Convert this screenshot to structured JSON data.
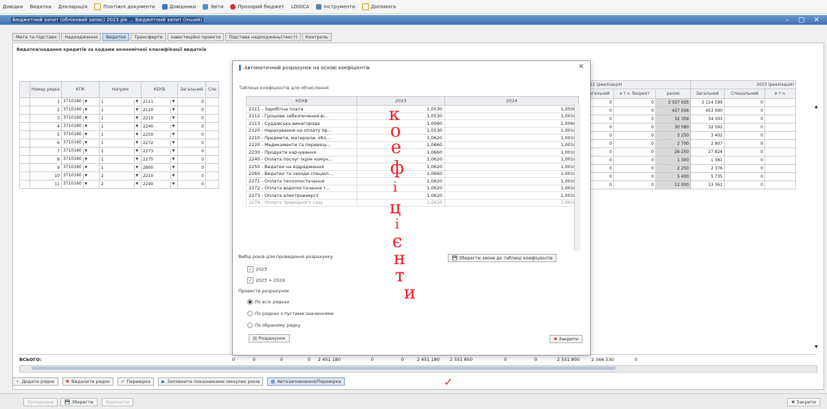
{
  "menu": [
    "Довідки",
    "Видатки",
    "Декларація",
    "Платіжні документи",
    "Довідники",
    "Звіти",
    "Прозорий бюджет",
    "LOGICA",
    "Інструменти",
    "Допомога"
  ],
  "window_title": "Бюджетний запит (обліковий запис) 2023 рік ... Бюджетний запит (Інший)",
  "tabs": [
    "Мета та підстави",
    "Надходження",
    "Видатки",
    "Трансферти",
    "Інвестиційні проекти",
    "Підстава надходжень(текст)",
    "Контроль"
  ],
  "section_title": "Видатки/надання кредитів за кодами економічної класифікації видатків",
  "left_headers": [
    "Номер рядка",
    "КПК",
    "Напрям",
    "КЕКВ",
    "Загальний",
    "Спе"
  ],
  "rows": [
    {
      "n": "1",
      "kpk": "3710160",
      "nap": "1",
      "kekv": "2111"
    },
    {
      "n": "2",
      "kpk": "3710160",
      "nap": "1",
      "kekv": "2120"
    },
    {
      "n": "3",
      "kpk": "3710160",
      "nap": "1",
      "kekv": "2210"
    },
    {
      "n": "4",
      "kpk": "3710160",
      "nap": "1",
      "kekv": "2240"
    },
    {
      "n": "5",
      "kpk": "3710160",
      "nap": "1",
      "kekv": "2250"
    },
    {
      "n": "6",
      "kpk": "3710160",
      "nap": "1",
      "kekv": "2272"
    },
    {
      "n": "7",
      "kpk": "3710160",
      "nap": "1",
      "kekv": "2273"
    },
    {
      "n": "8",
      "kpk": "3710160",
      "nap": "1",
      "kekv": "2275"
    },
    {
      "n": "9",
      "kpk": "3710160",
      "nap": "1",
      "kekv": "2800"
    },
    {
      "n": "10",
      "kpk": "3710160",
      "nap": "2",
      "kekv": "2210"
    },
    {
      "n": "11",
      "kpk": "3710160",
      "nap": "2",
      "kekv": "2240"
    }
  ],
  "right_group_2022": "2022 (реалізація)",
  "right_group_2023": "2023 (реалізація)",
  "right_headers": [
    "Загальний",
    "в т.ч. бюджет",
    "разом",
    "Загальний",
    "Спеціальний",
    "в т.ч."
  ],
  "right_rows": [
    [
      "0",
      "0",
      "2 037 025",
      "2 114 599",
      "0"
    ],
    [
      "0",
      "0",
      "437 056",
      "453 000",
      "0"
    ],
    [
      "0",
      "0",
      "32 359",
      "34 303",
      "0"
    ],
    [
      "0",
      "0",
      "30 080",
      "32 592",
      "0"
    ],
    [
      "0",
      "0",
      "3 250",
      "3 402",
      "0"
    ],
    [
      "0",
      "0",
      "2 700",
      "2 907",
      "0"
    ],
    [
      "0",
      "0",
      "26 250",
      "27 824",
      "0"
    ],
    [
      "0",
      "0",
      "1 300",
      "1 381",
      "0"
    ],
    [
      "0",
      "0",
      "2 250",
      "2 376",
      "0"
    ],
    [
      "0",
      "0",
      "5 400",
      "5 735",
      "0"
    ],
    [
      "0",
      "0",
      "12 000",
      "13 361",
      "0"
    ]
  ],
  "totals": {
    "label": "ВСЬОГО:",
    "values": [
      "0",
      "0",
      "0",
      "0",
      "2 451 180",
      "0",
      "0",
      "2 451 180",
      "2 551 850",
      "0",
      "0",
      "2 551 800",
      "2 566 530",
      "0"
    ]
  },
  "toolbar": [
    "Додати рядок",
    "Видалити рядок",
    "Перевірка",
    "Заповнити показниками минулих років",
    "Автозаповнення/Перевірка"
  ],
  "footer": {
    "first": "Попередня",
    "save": "Зберегти",
    "third": "Відмінити",
    "close": "Закрити"
  },
  "dialog": {
    "title": "Автоматичний розрахунок на основі коефіцієнтів",
    "subtitle": "Таблиця коефіцієнтів для обчислення",
    "col_headers": [
      "КЕКВ",
      "2023",
      "2024"
    ],
    "rows": [
      [
        "2111 - Заробітна плата",
        "1,0530",
        "1,0500"
      ],
      [
        "2112 - Грошове забезпечення ві...",
        "1,0530",
        "1,0010"
      ],
      [
        "2113 - Суддівська винагорода",
        "1,0060",
        "1,0060"
      ],
      [
        "2120 - Нарахування на оплату пр...",
        "1,0530",
        "1,0010"
      ],
      [
        "2210 - Предмети, матеріали, обл...",
        "1,0620",
        "1,0010"
      ],
      [
        "2220 - Медикаменти та перевязу...",
        "1,0660",
        "1,0010"
      ],
      [
        "2230 - Продукти харчування",
        "1,0660",
        "1,0010"
      ],
      [
        "2240 - Оплата послуг (крім комун...",
        "1,0620",
        "1,0010"
      ],
      [
        "2250 - Видатки на відрядження",
        "1,0620",
        "1,0010"
      ],
      [
        "2260 - Видатки та заходи спеціал...",
        "1,0660",
        "1,0010"
      ],
      [
        "2271 - Оплата теплопостачання",
        "1,0620",
        "1,0010"
      ],
      [
        "2272 - Оплата водопостачання т...",
        "1,0620",
        "1,0010"
      ],
      [
        "2273 - Оплата електроенергії",
        "1,0620",
        "1,0010"
      ],
      [
        "2274 - Оплата природного газу",
        "1,0620",
        "1,0010"
      ]
    ],
    "save_btn": "Зберегти зміни до таблиці коефіцієнтів",
    "years_label": "Вибір років для проведення розрахунку",
    "year1": "2023",
    "year2": "2023 + 2024",
    "calc_label": "Провести розрахунок",
    "opt1": "По всіх рядках",
    "opt2": "По рядках з пустими значеннями",
    "opt3": "По обраному рядку",
    "calc_btn": "Розрахунок",
    "close_btn": "Закрити"
  },
  "handwriting": [
    "к",
    "о",
    "е",
    "ф",
    "і",
    "ц",
    "і",
    "є",
    "н",
    "т",
    "и"
  ]
}
